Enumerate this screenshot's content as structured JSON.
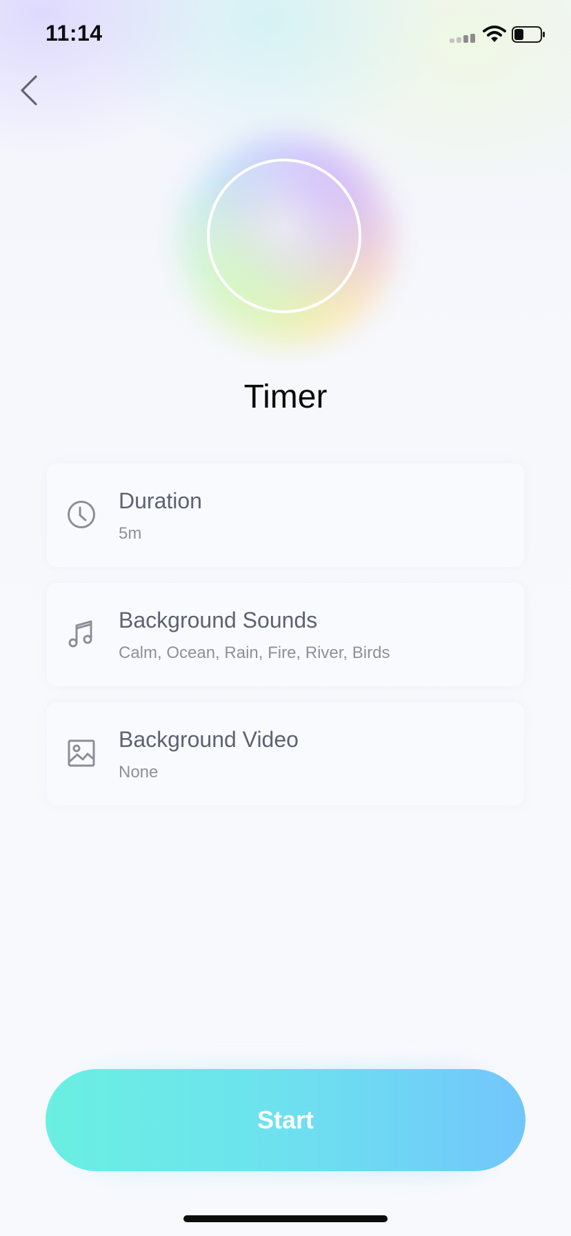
{
  "status_bar": {
    "time": "11:14",
    "signal_icon": "cellular-signal-icon",
    "wifi_icon": "wifi-icon",
    "battery_icon": "battery-icon",
    "battery_level": 0.35
  },
  "header": {
    "back_icon": "chevron-left-icon"
  },
  "hero": {
    "orb": "gradient-orb",
    "title": "Timer"
  },
  "settings": [
    {
      "icon": "clock-icon",
      "title": "Duration",
      "value": "5m"
    },
    {
      "icon": "music-note-icon",
      "title": "Background Sounds",
      "value": "Calm, Ocean, Rain, Fire, River, Birds"
    },
    {
      "icon": "image-icon",
      "title": "Background Video",
      "value": "None"
    }
  ],
  "footer": {
    "start_label": "Start"
  },
  "colors": {
    "start_gradient_from": "#6aefe2",
    "start_gradient_to": "#72c6fb",
    "card_title": "#5c6272",
    "card_subtitle": "#8c909a",
    "icon_stroke": "#8a8e98"
  }
}
